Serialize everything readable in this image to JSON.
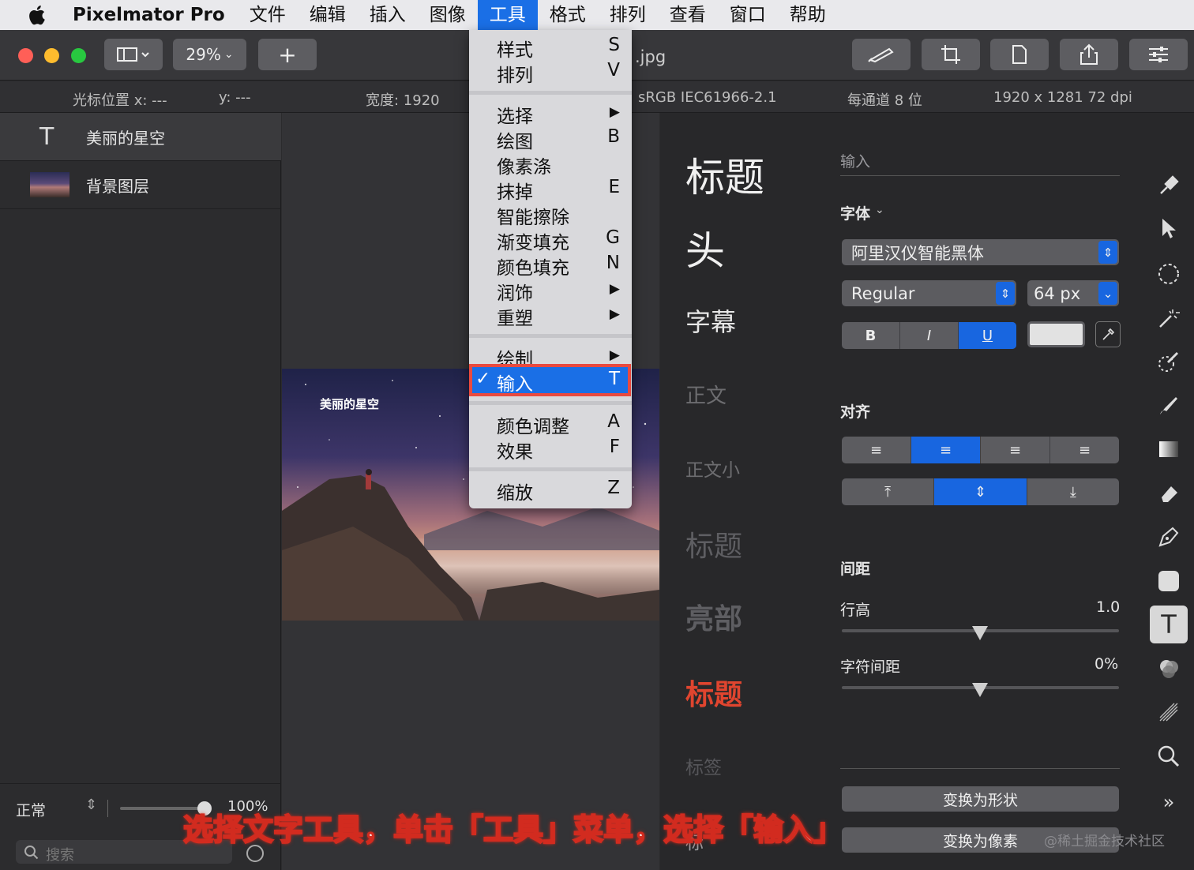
{
  "menubar": {
    "app": "Pixelmator Pro",
    "items": [
      "文件",
      "编辑",
      "插入",
      "图像",
      "工具",
      "格式",
      "排列",
      "查看",
      "窗口",
      "帮助"
    ]
  },
  "toolbar": {
    "zoom": "29%",
    "title": ".jpg"
  },
  "info": {
    "cursor_x": "光标位置 x:  ---",
    "cursor_y": "y:  ---",
    "width": "宽度:  1920",
    "colorspace": "sRGB IEC61966-2.1",
    "depth": "每通道 8 位",
    "size": "1920 x 1281 72 dpi"
  },
  "layers": [
    {
      "name": "美丽的星空"
    },
    {
      "name": "背景图层"
    }
  ],
  "layers_footer": {
    "blend": "正常",
    "opacity": "100%",
    "search_placeholder": "搜索"
  },
  "photo": {
    "text": "美丽的星空"
  },
  "presets": [
    "标题",
    "头",
    "字幕",
    "正文",
    "正文小",
    "标题",
    "亮部",
    "标题",
    "标签",
    "标"
  ],
  "inspector": {
    "input_placeholder": "输入",
    "font_label": "字体",
    "font_name": "阿里汉仪智能黑体",
    "style": "Regular",
    "size": "64 px",
    "bold": "B",
    "italic": "I",
    "underline": "U",
    "align_label": "对齐",
    "spacing_label": "间距",
    "line_height_label": "行高",
    "line_height": "1.0",
    "char_spacing_label": "字符间距",
    "char_spacing": "0%",
    "to_shape": "变换为形状",
    "to_pixels": "变换为像素"
  },
  "menu": {
    "items": [
      {
        "label": "样式",
        "key": "S"
      },
      {
        "label": "排列",
        "key": "V"
      },
      {
        "label": "选择",
        "key": "▶"
      },
      {
        "label": "绘图",
        "key": "B"
      },
      {
        "label": "像素涤",
        "key": ""
      },
      {
        "label": "抹掉",
        "key": "E"
      },
      {
        "label": "智能擦除",
        "key": ""
      },
      {
        "label": "渐变填充",
        "key": "G"
      },
      {
        "label": "颜色填充",
        "key": "N"
      },
      {
        "label": "润饰",
        "key": "▶"
      },
      {
        "label": "重塑",
        "key": "▶"
      },
      {
        "label": "绘制",
        "key": "▶"
      },
      {
        "label": "输入",
        "key": "T"
      },
      {
        "label": "颜色调整",
        "key": "A"
      },
      {
        "label": "效果",
        "key": "F"
      },
      {
        "label": "缩放",
        "key": "Z"
      }
    ],
    "check": "✓"
  },
  "caption": "选择文字工具，单击「工具」菜单，选择「输入」",
  "watermark": "@稀土掘金技术社区",
  "colors": {
    "accent": "#1a6fe6",
    "highlight_border": "#e94a3f",
    "preset_red": "#e0452f"
  }
}
